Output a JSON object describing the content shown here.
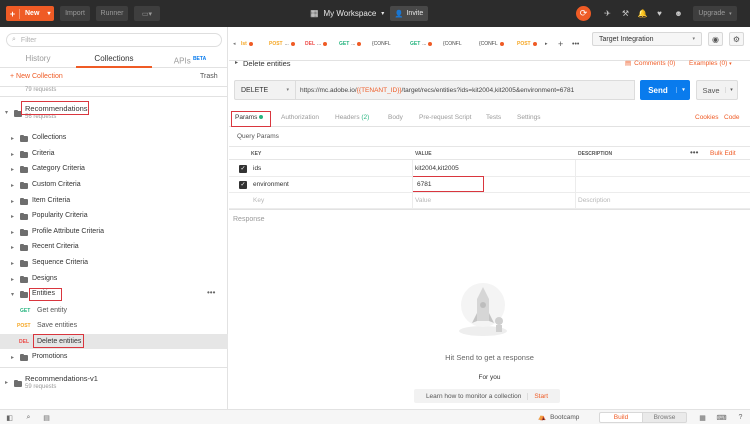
{
  "topbar": {
    "new_label": "New",
    "import_label": "Import",
    "runner_label": "Runner",
    "workspace_label": "My Workspace",
    "invite_label": "Invite",
    "upgrade_label": "Upgrade",
    "accent": "#ef5b25"
  },
  "sidebar": {
    "filter_placeholder": "Filter",
    "tabs": [
      {
        "label": "History"
      },
      {
        "label": "Collections",
        "active": true
      },
      {
        "label": "APIs",
        "badge": "BETA"
      }
    ],
    "new_collection": "New Collection",
    "trash": "Trash",
    "top_cut_text": "79 requests",
    "collection": {
      "name": "Recommendations",
      "count": "56 requests"
    },
    "folders": [
      "Collections",
      "Criteria",
      "Category Criteria",
      "Custom Criteria",
      "Item Criteria",
      "Popularity Criteria",
      "Profile Attribute Criteria",
      "Recent Criteria",
      "Sequence Criteria",
      "Designs"
    ],
    "open_folder": "Entities",
    "requests": [
      {
        "method": "GET",
        "name": "Get entity",
        "color": "#26b47f"
      },
      {
        "method": "POST",
        "name": "Save entities",
        "color": "#f5a623"
      },
      {
        "method": "DEL",
        "name": "Delete entities",
        "color": "#ed4b48"
      }
    ],
    "last_folder": "Promotions",
    "collection2": {
      "name": "Recommendations-v1",
      "count": "59 requests"
    }
  },
  "request_tabs": [
    {
      "method": "Ist",
      "color": "#f5a623"
    },
    {
      "method": "POST",
      "color": "#f5a623",
      "label": "..."
    },
    {
      "method": "DEL",
      "color": "#ed4b48",
      "label": "..."
    },
    {
      "method": "GET",
      "color": "#26b47f",
      "label": "..."
    },
    {
      "label": "{CONFL"
    },
    {
      "method": "GET",
      "color": "#26b47f",
      "label": "..."
    },
    {
      "label": "{CONFL"
    },
    {
      "label": "{CONFL"
    },
    {
      "method": "POST",
      "color": "#f5a623"
    }
  ],
  "environment": "Target Integration",
  "request": {
    "title": "Delete entities",
    "comments": "Comments (0)",
    "examples": "Examples (0)",
    "method": "DELETE",
    "url_prefix": "https://mc.adobe.io/",
    "url_var": "{{TENANT_ID}}",
    "url_suffix": "/target/recs/entities?ids=kit2004,kit2005&environment=6781",
    "send_label": "Send",
    "save_label": "Save"
  },
  "param_tabs": {
    "params": "Params",
    "authorization": "Authorization",
    "headers": "Headers",
    "headers_count": "(2)",
    "body": "Body",
    "prerequest": "Pre-request Script",
    "tests": "Tests",
    "settings": "Settings",
    "cookies": "Cookies",
    "code": "Code"
  },
  "params": {
    "title": "Query Params",
    "headers": [
      "KEY",
      "VALUE",
      "DESCRIPTION"
    ],
    "bulk_edit": "Bulk Edit",
    "rows": [
      {
        "key": "ids",
        "value": "kit2004,kit2005",
        "description": ""
      },
      {
        "key": "environment",
        "value": "6781",
        "description": ""
      }
    ],
    "placeholder_row": {
      "key": "Key",
      "value": "Value",
      "description": "Description"
    }
  },
  "response": {
    "title": "Response",
    "empty_text": "Hit Send to get a response",
    "for_you": "For you",
    "learn": "Learn how to monitor a collection",
    "start": "Start"
  },
  "footer": {
    "bootcamp": "Bootcamp",
    "build": "Build",
    "browse": "Browse"
  }
}
